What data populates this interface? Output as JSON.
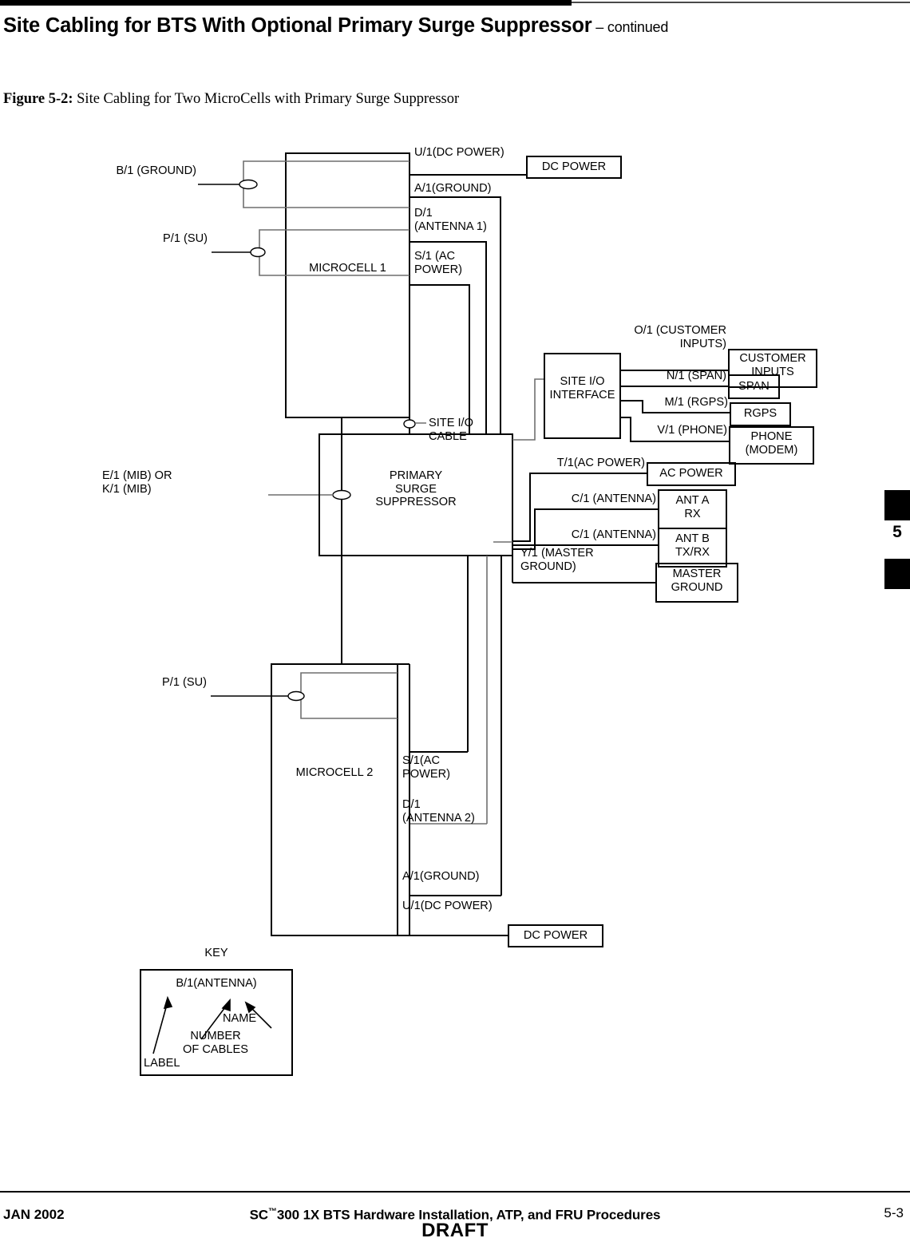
{
  "header": {
    "title_main": "Site Cabling for BTS With Optional Primary Surge Suppressor",
    "title_cont": " – continued",
    "figure_label": "Figure 5-2:",
    "figure_caption": " Site Cabling for Two MicroCells with Primary Surge Suppressor"
  },
  "chapter_tab": {
    "number": "5"
  },
  "diagram": {
    "blocks": {
      "microcell1": "MICROCELL 1",
      "microcell2": "MICROCELL 2",
      "surge_suppressor": "PRIMARY\nSURGE\nSUPPRESSOR",
      "site_io_interface": "SITE I/O\nINTERFACE",
      "dc_power_top": "DC POWER",
      "dc_power_bottom": "DC POWER",
      "customer_inputs": "CUSTOMER\nINPUTS",
      "span": "SPAN",
      "rgps": "RGPS",
      "phone_modem": "PHONE\n(MODEM)",
      "ac_power": "AC POWER",
      "ant_a_rx": "ANT A\nRX",
      "ant_b_txrx": "ANT B\nTX/RX",
      "master_ground": "MASTER\nGROUND"
    },
    "cable_labels": {
      "b1_ground": "B/1 (GROUND)",
      "p1_su_top": "P/1 (SU)",
      "p1_su_bottom": "P/1 (SU)",
      "e1k1_mib": "E/1 (MIB) OR\nK/1 (MIB)",
      "u1_dc_power_top": "U/1(DC POWER)",
      "a1_ground_top": "A/1(GROUND)",
      "d1_antenna1": "D/1\n(ANTENNA 1)",
      "s1_ac_power_top": "S/1 (AC\nPOWER)",
      "site_io_cable": "SITE I/O\nCABLE",
      "o1_customer_inputs": "O/1 (CUSTOMER\nINPUTS)",
      "n1_span": "N/1 (SPAN)",
      "m1_rgps": "M/1 (RGPS)",
      "v1_phone": "V/1 (PHONE)",
      "t1_ac_power": "T/1(AC POWER)",
      "c1_antenna_a": "C/1 (ANTENNA)",
      "c1_antenna_b": "C/1 (ANTENNA)",
      "y1_master_ground": "Y/1 (MASTER\nGROUND)",
      "s1_ac_power_bottom": "S/1(AC\nPOWER)",
      "d1_antenna2": "D/1\n(ANTENNA 2)",
      "a1_ground_bottom": "A/1(GROUND)",
      "u1_dc_power_bottom": "U/1(DC POWER)"
    },
    "key": {
      "title": "KEY",
      "sample": "B/1(ANTENNA)",
      "name": "NAME",
      "number_of_cables": "NUMBER\nOF CABLES",
      "label": "LABEL"
    }
  },
  "footer": {
    "date": "JAN 2002",
    "title_pre": "SC",
    "title_tm": "™",
    "title_post": "300 1X BTS Hardware Installation, ATP, and FRU Procedures",
    "page": "5-3",
    "draft": "DRAFT"
  }
}
